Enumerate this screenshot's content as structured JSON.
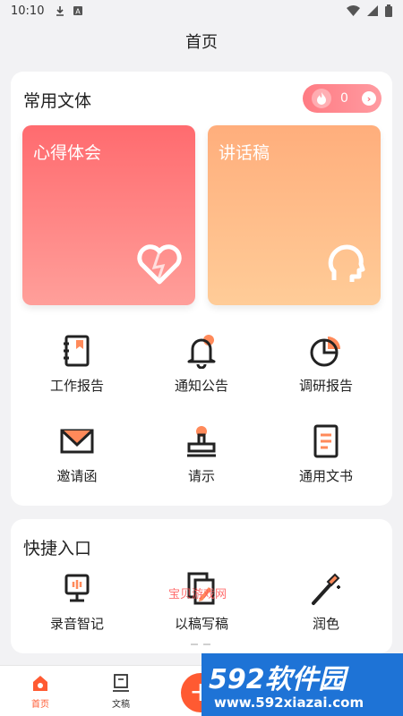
{
  "status_bar": {
    "time": "10:10"
  },
  "header": {
    "title": "首页"
  },
  "section1": {
    "title": "常用文体",
    "counter": "0",
    "features": [
      {
        "label": "心得体会"
      },
      {
        "label": "讲话稿"
      }
    ],
    "grid": [
      {
        "label": "工作报告",
        "icon": "notebook-icon"
      },
      {
        "label": "通知公告",
        "icon": "bell-icon"
      },
      {
        "label": "调研报告",
        "icon": "pie-chart-icon"
      },
      {
        "label": "邀请函",
        "icon": "envelope-icon"
      },
      {
        "label": "请示",
        "icon": "stamp-icon"
      },
      {
        "label": "通用文书",
        "icon": "document-icon"
      }
    ]
  },
  "section2": {
    "title": "快捷入口",
    "items": [
      {
        "label": "录音智记",
        "icon": "recorder-icon"
      },
      {
        "label": "以稿写稿",
        "icon": "copy-edit-icon"
      },
      {
        "label": "润色",
        "icon": "magic-wand-icon"
      }
    ]
  },
  "bottom_nav": {
    "items": [
      {
        "label": "首页",
        "active": true
      },
      {
        "label": "文稿",
        "active": false
      }
    ],
    "fab": "+"
  },
  "watermark": {
    "text": "宝贝游戏网",
    "brand": "592软件园",
    "url": "www.592xiazai.com"
  },
  "colors": {
    "accent": "#ff5a32",
    "card_left": "#ff6b6f",
    "card_right": "#ffae7c"
  }
}
